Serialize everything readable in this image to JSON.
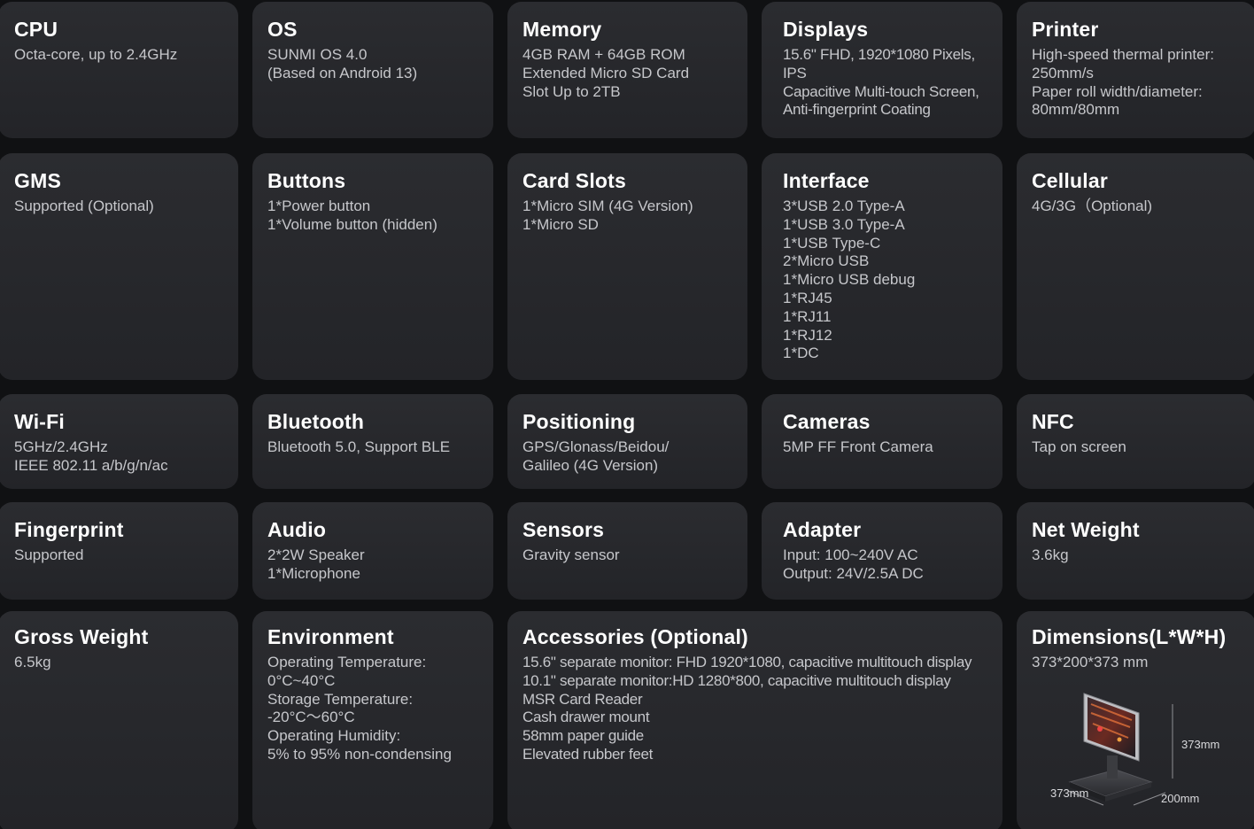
{
  "cards": [
    {
      "title": "CPU",
      "lines": [
        "Octa-core, up to 2.4GHz"
      ]
    },
    {
      "title": "OS",
      "lines": [
        "SUNMI OS 4.0",
        "(Based on Android 13)"
      ]
    },
    {
      "title": "Memory",
      "lines": [
        "4GB RAM + 64GB ROM",
        "Extended Micro SD Card",
        "Slot Up to 2TB"
      ]
    },
    {
      "title": "Displays",
      "lines": [
        "15.6\" FHD, 1920*1080 Pixels,",
        "IPS",
        "Capacitive Multi-touch Screen,",
        "Anti-fingerprint Coating"
      ]
    },
    {
      "title": "Printer",
      "lines": [
        "High-speed thermal printer:",
        "250mm/s",
        "Paper roll width/diameter:",
        "80mm/80mm"
      ]
    },
    {
      "title": "GMS",
      "lines": [
        "Supported (Optional)"
      ]
    },
    {
      "title": "Buttons",
      "lines": [
        "1*Power button",
        "1*Volume button (hidden)"
      ]
    },
    {
      "title": "Card Slots",
      "lines": [
        "1*Micro SIM (4G Version)",
        "1*Micro SD"
      ]
    },
    {
      "title": "Interface",
      "lines": [
        "3*USB 2.0 Type-A",
        "1*USB 3.0 Type-A",
        "1*USB Type-C",
        "2*Micro USB",
        "1*Micro USB debug",
        "1*RJ45",
        "1*RJ11",
        "1*RJ12",
        "1*DC"
      ]
    },
    {
      "title": "Cellular",
      "lines": [
        "4G/3G（Optional)"
      ]
    },
    {
      "title": "Wi-Fi",
      "lines": [
        "5GHz/2.4GHz",
        "IEEE 802.11 a/b/g/n/ac"
      ]
    },
    {
      "title": "Bluetooth",
      "lines": [
        "Bluetooth 5.0, Support BLE"
      ]
    },
    {
      "title": "Positioning",
      "lines": [
        "GPS/Glonass/Beidou/",
        "Galileo (4G Version)"
      ]
    },
    {
      "title": "Cameras",
      "lines": [
        "5MP FF Front Camera"
      ]
    },
    {
      "title": "NFC",
      "lines": [
        "Tap on screen"
      ]
    },
    {
      "title": "Fingerprint",
      "lines": [
        "Supported"
      ]
    },
    {
      "title": "Audio",
      "lines": [
        "2*2W Speaker",
        "1*Microphone"
      ]
    },
    {
      "title": "Sensors",
      "lines": [
        "Gravity sensor"
      ]
    },
    {
      "title": "Adapter",
      "lines": [
        "Input: 100~240V AC",
        "Output: 24V/2.5A DC"
      ]
    },
    {
      "title": "Net Weight",
      "lines": [
        "3.6kg"
      ]
    },
    {
      "title": "Gross Weight",
      "lines": [
        "6.5kg"
      ]
    },
    {
      "title": "Environment",
      "lines": [
        "Operating Temperature:",
        "0°C~40°C",
        "Storage Temperature:",
        "-20°C～60°C",
        "Operating Humidity:",
        "5% to 95% non-condensing"
      ]
    },
    {
      "title": "Accessories (Optional)",
      "lines": [
        "15.6\" separate monitor: FHD 1920*1080, capacitive multitouch display",
        "10.1\" separate monitor:HD 1280*800, capacitive multitouch display",
        "MSR Card Reader",
        "Cash drawer mount",
        "58mm paper guide",
        "Elevated rubber feet"
      ]
    },
    {
      "title": "Dimensions(L*W*H)",
      "lines": [
        "373*200*373 mm"
      ]
    }
  ],
  "dimension_labels": {
    "height": "373mm",
    "length": "373mm",
    "width": "200mm"
  },
  "colors": {
    "background": "#101113",
    "card": "#27282c",
    "title": "#ffffff",
    "text": "#c6c7cb"
  }
}
